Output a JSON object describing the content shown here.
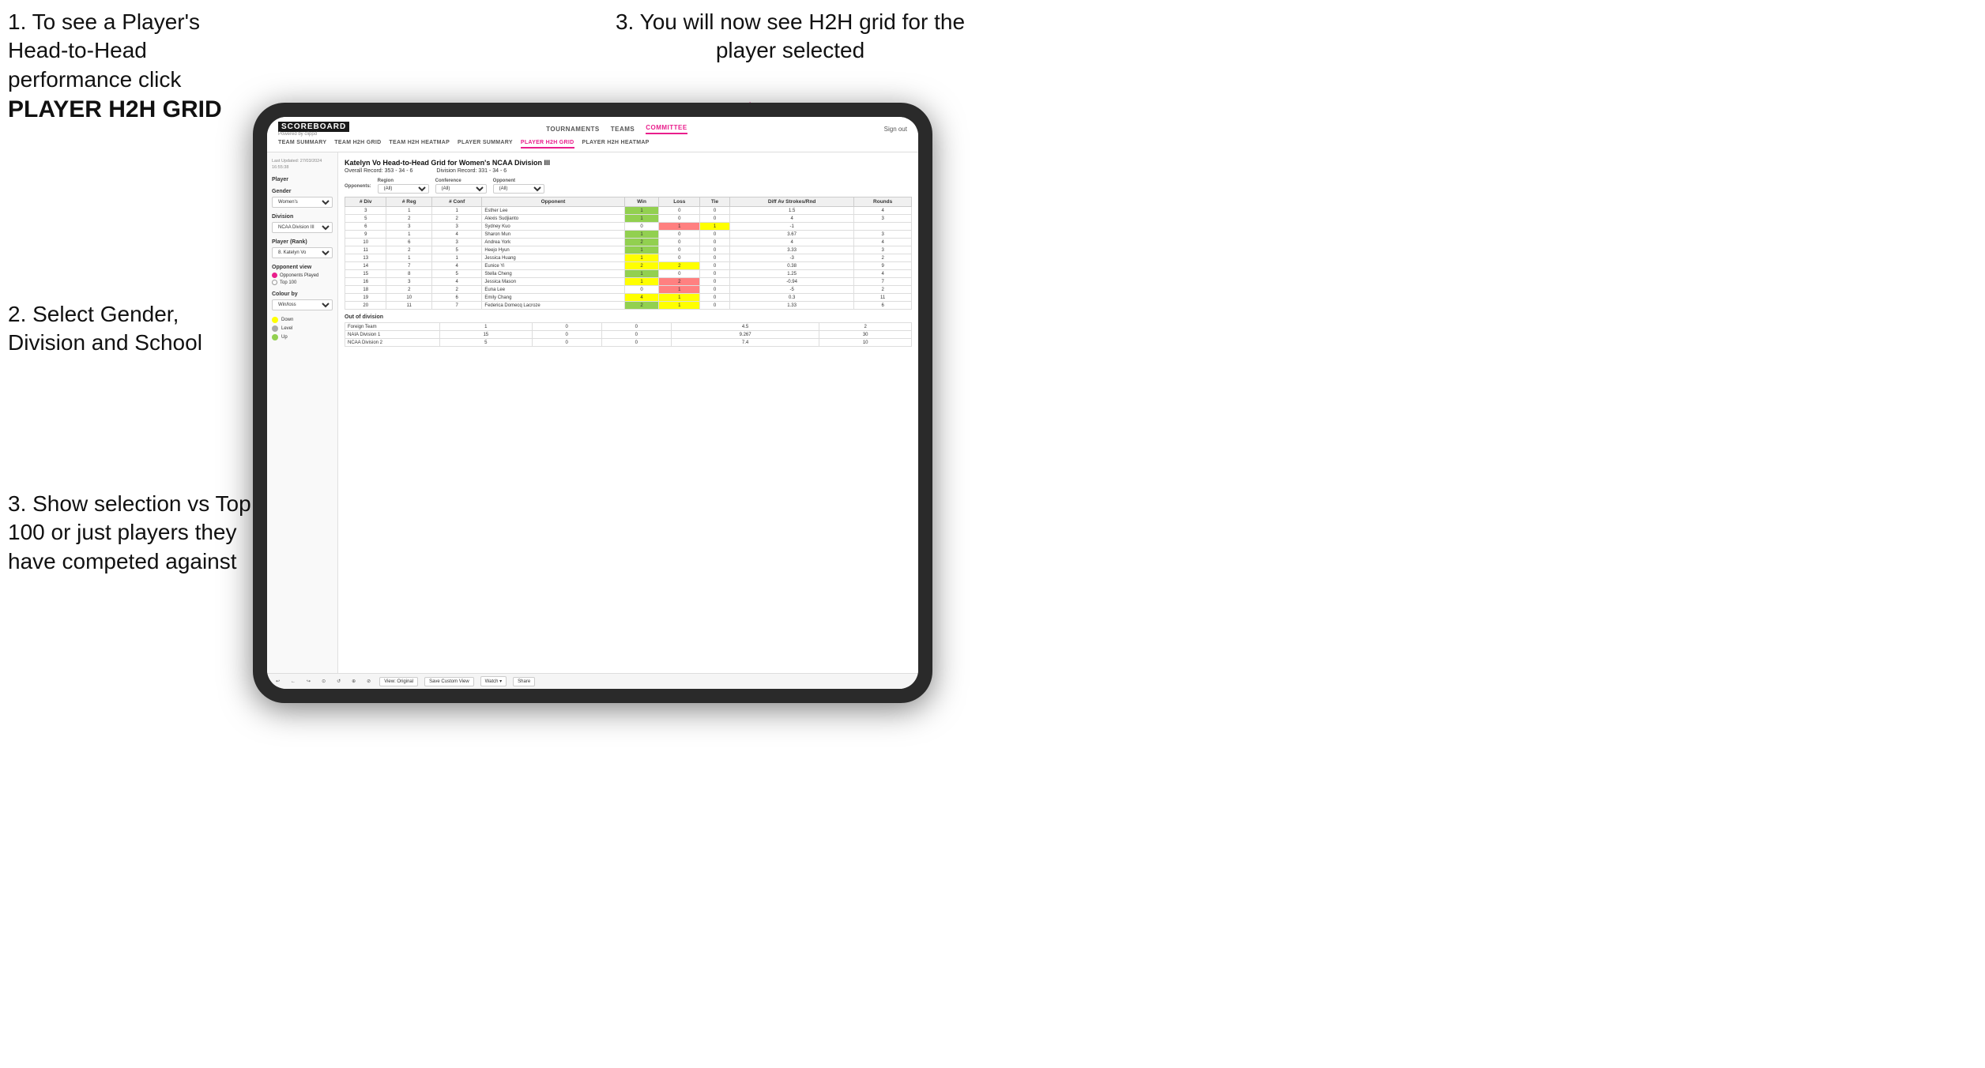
{
  "instructions": {
    "top_left_1": "1. To see a Player's Head-to-Head performance click",
    "top_left_bold": "PLAYER H2H GRID",
    "top_right": "3. You will now see H2H grid for the player selected",
    "mid_left_title": "2. Select Gender, Division and School",
    "bottom_left": "3. Show selection vs Top 100 or just players they have competed against"
  },
  "nav": {
    "logo": "SCOREBOARD",
    "logo_sub": "Powered by clippd",
    "links": [
      "TOURNAMENTS",
      "TEAMS",
      "COMMITTEE"
    ],
    "active_link": "COMMITTEE",
    "sign_out": "Sign out",
    "sub_links": [
      "TEAM SUMMARY",
      "TEAM H2H GRID",
      "TEAM H2H HEATMAP",
      "PLAYER SUMMARY",
      "PLAYER H2H GRID",
      "PLAYER H2H HEATMAP"
    ],
    "active_sub": "PLAYER H2H GRID"
  },
  "sidebar": {
    "last_updated": "Last Updated: 27/03/2024\n16:55:38",
    "player_label": "Player",
    "gender_label": "Gender",
    "gender_value": "Women's",
    "division_label": "Division",
    "division_value": "NCAA Division III",
    "player_rank_label": "Player (Rank)",
    "player_rank_value": "8. Katelyn Vo",
    "opponent_view_label": "Opponent view",
    "opponent_played": "Opponents Played",
    "top_100": "Top 100",
    "colour_by_label": "Colour by",
    "colour_by_value": "Win/loss",
    "legend": {
      "down_label": "Down",
      "level_label": "Level",
      "up_label": "Up",
      "down_color": "#ffff00",
      "level_color": "#aaaaaa",
      "up_color": "#92d050"
    }
  },
  "grid": {
    "title": "Katelyn Vo Head-to-Head Grid for Women's NCAA Division III",
    "overall_record_label": "Overall Record:",
    "overall_record": "353 - 34 - 6",
    "division_record_label": "Division Record:",
    "division_record": "331 - 34 - 6",
    "filters": {
      "opponents_label": "Opponents:",
      "region_label": "Region",
      "region_value": "(All)",
      "conference_label": "Conference",
      "conference_value": "(All)",
      "opponent_label": "Opponent",
      "opponent_value": "(All)"
    },
    "table_headers": [
      "# Div",
      "# Reg",
      "# Conf",
      "Opponent",
      "Win",
      "Loss",
      "Tie",
      "Diff Av Strokes/Rnd",
      "Rounds"
    ],
    "rows": [
      {
        "div": 3,
        "reg": 1,
        "conf": 1,
        "opponent": "Esther Lee",
        "win": 1,
        "loss": 0,
        "tie": 0,
        "diff": 1.5,
        "rounds": 4,
        "win_color": "green",
        "loss_color": "",
        "tie_color": ""
      },
      {
        "div": 5,
        "reg": 2,
        "conf": 2,
        "opponent": "Alexis Sudjianto",
        "win": 1,
        "loss": 0,
        "tie": 0,
        "diff": 4.0,
        "rounds": 3,
        "win_color": "green",
        "loss_color": "",
        "tie_color": ""
      },
      {
        "div": 6,
        "reg": 3,
        "conf": 3,
        "opponent": "Sydney Kuo",
        "win": 0,
        "loss": 1,
        "tie": 1,
        "diff": -1.0,
        "rounds": "",
        "win_color": "",
        "loss_color": "red",
        "tie_color": "yellow"
      },
      {
        "div": 9,
        "reg": 1,
        "conf": 4,
        "opponent": "Sharon Mun",
        "win": 1,
        "loss": 0,
        "tie": 0,
        "diff": 3.67,
        "rounds": 3,
        "win_color": "green",
        "loss_color": "",
        "tie_color": ""
      },
      {
        "div": 10,
        "reg": 6,
        "conf": 3,
        "opponent": "Andrea York",
        "win": 2,
        "loss": 0,
        "tie": 0,
        "diff": 4.0,
        "rounds": 4,
        "win_color": "green",
        "loss_color": "",
        "tie_color": ""
      },
      {
        "div": 11,
        "reg": 2,
        "conf": 5,
        "opponent": "Heejo Hyun",
        "win": 1,
        "loss": 0,
        "tie": 0,
        "diff": 3.33,
        "rounds": 3,
        "win_color": "green",
        "loss_color": "",
        "tie_color": ""
      },
      {
        "div": 13,
        "reg": 1,
        "conf": 1,
        "opponent": "Jessica Huang",
        "win": 1,
        "loss": 0,
        "tie": 0,
        "diff": -3.0,
        "rounds": 2,
        "win_color": "yellow",
        "loss_color": "",
        "tie_color": ""
      },
      {
        "div": 14,
        "reg": 7,
        "conf": 4,
        "opponent": "Eunice Yi",
        "win": 2,
        "loss": 2,
        "tie": 0,
        "diff": 0.38,
        "rounds": 9,
        "win_color": "yellow",
        "loss_color": "yellow",
        "tie_color": ""
      },
      {
        "div": 15,
        "reg": 8,
        "conf": 5,
        "opponent": "Stella Cheng",
        "win": 1,
        "loss": 0,
        "tie": 0,
        "diff": 1.25,
        "rounds": 4,
        "win_color": "green",
        "loss_color": "",
        "tie_color": ""
      },
      {
        "div": 16,
        "reg": 3,
        "conf": 4,
        "opponent": "Jessica Mason",
        "win": 1,
        "loss": 2,
        "tie": 0,
        "diff": -0.94,
        "rounds": 7,
        "win_color": "yellow",
        "loss_color": "red",
        "tie_color": ""
      },
      {
        "div": 18,
        "reg": 2,
        "conf": 2,
        "opponent": "Euna Lee",
        "win": 0,
        "loss": 1,
        "tie": 0,
        "diff": -5.0,
        "rounds": 2,
        "win_color": "",
        "loss_color": "red",
        "tie_color": ""
      },
      {
        "div": 19,
        "reg": 10,
        "conf": 6,
        "opponent": "Emily Chang",
        "win": 4,
        "loss": 1,
        "tie": 0,
        "diff": 0.3,
        "rounds": 11,
        "win_color": "yellow",
        "loss_color": "yellow",
        "tie_color": ""
      },
      {
        "div": 20,
        "reg": 11,
        "conf": 7,
        "opponent": "Federica Domecq Lacroze",
        "win": 2,
        "loss": 1,
        "tie": 0,
        "diff": 1.33,
        "rounds": 6,
        "win_color": "green",
        "loss_color": "yellow",
        "tie_color": ""
      }
    ],
    "out_of_division_label": "Out of division",
    "out_of_division_rows": [
      {
        "opponent": "Foreign Team",
        "win": 1,
        "loss": 0,
        "tie": 0,
        "diff": 4.5,
        "rounds": 2
      },
      {
        "opponent": "NAIA Division 1",
        "win": 15,
        "loss": 0,
        "tie": 0,
        "diff": 9.267,
        "rounds": 30
      },
      {
        "opponent": "NCAA Division 2",
        "win": 5,
        "loss": 0,
        "tie": 0,
        "diff": 7.4,
        "rounds": 10
      }
    ]
  },
  "toolbar": {
    "buttons": [
      "↩",
      "←",
      "↪",
      "⊙",
      "↺",
      "⊕",
      "⊘"
    ],
    "view_original": "View: Original",
    "save_custom": "Save Custom View",
    "watch": "Watch ▾",
    "share": "Share"
  }
}
